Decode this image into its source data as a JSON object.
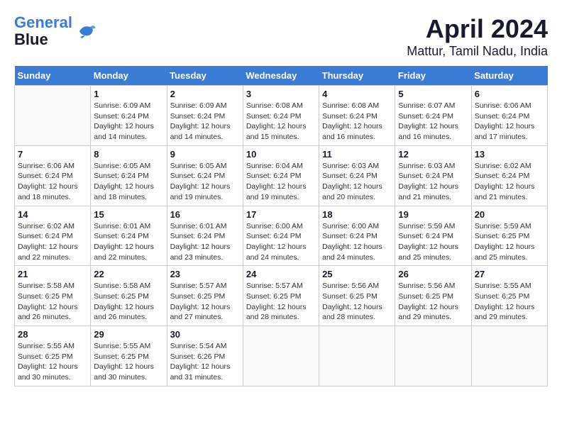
{
  "header": {
    "logo_line1": "General",
    "logo_line2": "Blue",
    "main_title": "April 2024",
    "subtitle": "Mattur, Tamil Nadu, India"
  },
  "days_of_week": [
    "Sunday",
    "Monday",
    "Tuesday",
    "Wednesday",
    "Thursday",
    "Friday",
    "Saturday"
  ],
  "weeks": [
    [
      {
        "num": "",
        "info": ""
      },
      {
        "num": "1",
        "info": "Sunrise: 6:09 AM\nSunset: 6:24 PM\nDaylight: 12 hours\nand 14 minutes."
      },
      {
        "num": "2",
        "info": "Sunrise: 6:09 AM\nSunset: 6:24 PM\nDaylight: 12 hours\nand 14 minutes."
      },
      {
        "num": "3",
        "info": "Sunrise: 6:08 AM\nSunset: 6:24 PM\nDaylight: 12 hours\nand 15 minutes."
      },
      {
        "num": "4",
        "info": "Sunrise: 6:08 AM\nSunset: 6:24 PM\nDaylight: 12 hours\nand 16 minutes."
      },
      {
        "num": "5",
        "info": "Sunrise: 6:07 AM\nSunset: 6:24 PM\nDaylight: 12 hours\nand 16 minutes."
      },
      {
        "num": "6",
        "info": "Sunrise: 6:06 AM\nSunset: 6:24 PM\nDaylight: 12 hours\nand 17 minutes."
      }
    ],
    [
      {
        "num": "7",
        "info": "Sunrise: 6:06 AM\nSunset: 6:24 PM\nDaylight: 12 hours\nand 18 minutes."
      },
      {
        "num": "8",
        "info": "Sunrise: 6:05 AM\nSunset: 6:24 PM\nDaylight: 12 hours\nand 18 minutes."
      },
      {
        "num": "9",
        "info": "Sunrise: 6:05 AM\nSunset: 6:24 PM\nDaylight: 12 hours\nand 19 minutes."
      },
      {
        "num": "10",
        "info": "Sunrise: 6:04 AM\nSunset: 6:24 PM\nDaylight: 12 hours\nand 19 minutes."
      },
      {
        "num": "11",
        "info": "Sunrise: 6:03 AM\nSunset: 6:24 PM\nDaylight: 12 hours\nand 20 minutes."
      },
      {
        "num": "12",
        "info": "Sunrise: 6:03 AM\nSunset: 6:24 PM\nDaylight: 12 hours\nand 21 minutes."
      },
      {
        "num": "13",
        "info": "Sunrise: 6:02 AM\nSunset: 6:24 PM\nDaylight: 12 hours\nand 21 minutes."
      }
    ],
    [
      {
        "num": "14",
        "info": "Sunrise: 6:02 AM\nSunset: 6:24 PM\nDaylight: 12 hours\nand 22 minutes."
      },
      {
        "num": "15",
        "info": "Sunrise: 6:01 AM\nSunset: 6:24 PM\nDaylight: 12 hours\nand 22 minutes."
      },
      {
        "num": "16",
        "info": "Sunrise: 6:01 AM\nSunset: 6:24 PM\nDaylight: 12 hours\nand 23 minutes."
      },
      {
        "num": "17",
        "info": "Sunrise: 6:00 AM\nSunset: 6:24 PM\nDaylight: 12 hours\nand 24 minutes."
      },
      {
        "num": "18",
        "info": "Sunrise: 6:00 AM\nSunset: 6:24 PM\nDaylight: 12 hours\nand 24 minutes."
      },
      {
        "num": "19",
        "info": "Sunrise: 5:59 AM\nSunset: 6:24 PM\nDaylight: 12 hours\nand 25 minutes."
      },
      {
        "num": "20",
        "info": "Sunrise: 5:59 AM\nSunset: 6:25 PM\nDaylight: 12 hours\nand 25 minutes."
      }
    ],
    [
      {
        "num": "21",
        "info": "Sunrise: 5:58 AM\nSunset: 6:25 PM\nDaylight: 12 hours\nand 26 minutes."
      },
      {
        "num": "22",
        "info": "Sunrise: 5:58 AM\nSunset: 6:25 PM\nDaylight: 12 hours\nand 26 minutes."
      },
      {
        "num": "23",
        "info": "Sunrise: 5:57 AM\nSunset: 6:25 PM\nDaylight: 12 hours\nand 27 minutes."
      },
      {
        "num": "24",
        "info": "Sunrise: 5:57 AM\nSunset: 6:25 PM\nDaylight: 12 hours\nand 28 minutes."
      },
      {
        "num": "25",
        "info": "Sunrise: 5:56 AM\nSunset: 6:25 PM\nDaylight: 12 hours\nand 28 minutes."
      },
      {
        "num": "26",
        "info": "Sunrise: 5:56 AM\nSunset: 6:25 PM\nDaylight: 12 hours\nand 29 minutes."
      },
      {
        "num": "27",
        "info": "Sunrise: 5:55 AM\nSunset: 6:25 PM\nDaylight: 12 hours\nand 29 minutes."
      }
    ],
    [
      {
        "num": "28",
        "info": "Sunrise: 5:55 AM\nSunset: 6:25 PM\nDaylight: 12 hours\nand 30 minutes."
      },
      {
        "num": "29",
        "info": "Sunrise: 5:55 AM\nSunset: 6:25 PM\nDaylight: 12 hours\nand 30 minutes."
      },
      {
        "num": "30",
        "info": "Sunrise: 5:54 AM\nSunset: 6:26 PM\nDaylight: 12 hours\nand 31 minutes."
      },
      {
        "num": "",
        "info": ""
      },
      {
        "num": "",
        "info": ""
      },
      {
        "num": "",
        "info": ""
      },
      {
        "num": "",
        "info": ""
      }
    ]
  ]
}
